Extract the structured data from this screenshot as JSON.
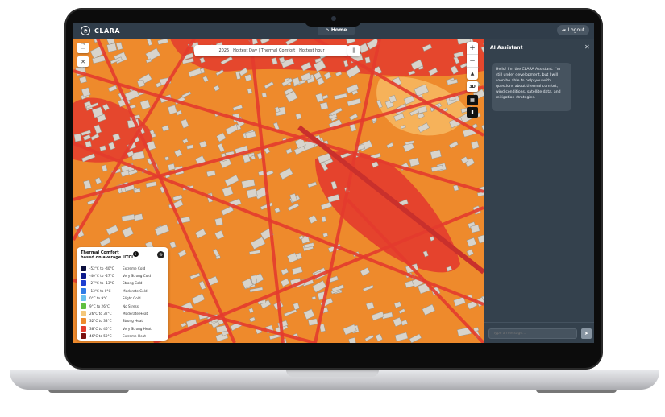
{
  "app": {
    "name": "CLARA",
    "logo_glyph": "◔",
    "home_label": "Home",
    "home_icon": "home-icon",
    "logout_label": "Logout",
    "logout_icon": "logout-arrow-icon"
  },
  "map": {
    "title": "2025 | Hottest Day | Thermal Comfort | Hottest hour",
    "controls": {
      "zoom_in": "+",
      "zoom_out": "−",
      "compass": "▲",
      "view_mode": "3D"
    }
  },
  "legend": {
    "title_line1": "Thermal Comfort",
    "title_line2": "based on average UTCI",
    "info_glyph": "i",
    "items": [
      {
        "range": "-52°C to -40°C",
        "label": "Extreme Cold",
        "color": "#0b0e3d"
      },
      {
        "range": "-40°C to -27°C",
        "label": "Very Strong Cold",
        "color": "#0d1a8c"
      },
      {
        "range": "-27°C to -13°C",
        "label": "Strong Cold",
        "color": "#1e3fd1"
      },
      {
        "range": "-13°C to 0°C",
        "label": "Moderate Cold",
        "color": "#2f7be6"
      },
      {
        "range": "0°C to 9°C",
        "label": "Slight Cold",
        "color": "#67c0ef"
      },
      {
        "range": "9°C to 26°C",
        "label": "No Stress",
        "color": "#5fbf3f"
      },
      {
        "range": "26°C to 32°C",
        "label": "Moderate Heat",
        "color": "#f4c77a"
      },
      {
        "range": "32°C to 38°C",
        "label": "Strong Heat",
        "color": "#ee8a2c"
      },
      {
        "range": "38°C to 46°C",
        "label": "Very Strong Heat",
        "color": "#e33b2e"
      },
      {
        "range": "46°C to 50°C",
        "label": "Extreme Heat",
        "color": "#7a0f0f"
      }
    ]
  },
  "assistant": {
    "title": "AI Assistant",
    "close_glyph": "✕",
    "message": "Hello! I'm the CLARA Assistant. I'm still under development, but I will soon be able to help you with questions about thermal comfort, wind conditions, satellite data, and mitigation strategies.",
    "input_placeholder": "Type a message...",
    "send_glyph": "➤"
  },
  "colors": {
    "topbar": "#303d4a",
    "panel": "#34414d",
    "heat_strong": "#ee8a2c",
    "heat_very_strong": "#e33b2e",
    "building": "#d8d4cc"
  }
}
